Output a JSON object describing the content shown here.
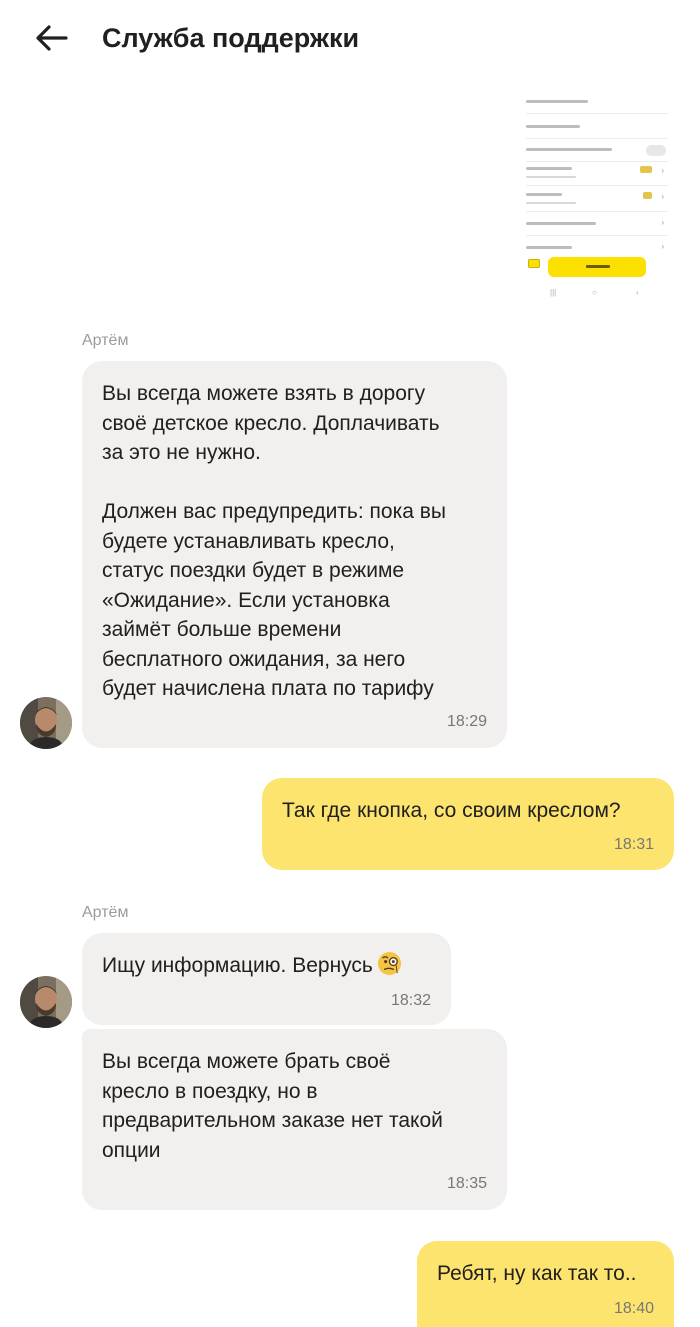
{
  "header": {
    "title": "Служба поддержки",
    "back_icon": "arrow-left-icon"
  },
  "messages": [
    {
      "sender": "Артём",
      "text": "Вы всегда можете взять в дорогу\nсвоё детское кресло. Доплачивать\nза это не нужно.\n\nДолжен вас предупредить: пока вы\nбудете устанавливать кресло,\nстатус поездки будет в режиме\n«Ожидание». Если установка\nзаймёт больше времени\nбесплатного ожидания, за него\nбудет начислена плата по тарифу",
      "time": "18:29"
    },
    {
      "text": "Так где кнопка, со своим креслом?",
      "time": "18:31"
    },
    {
      "sender": "Артём",
      "text": "Ищу информацию. Вернусь",
      "emoji": "monocle-face-emoji",
      "time": "18:32"
    },
    {
      "text": "Вы всегда можете брать своё\nкресло в поездку, но в\nпредварительном заказе нет такой\nопции",
      "time": "18:35"
    },
    {
      "text": "Ребят, ну как так то..",
      "time": "18:40"
    }
  ],
  "colors": {
    "incoming_bubble": "#f1f0ee",
    "outgoing_bubble": "#fce46e",
    "accent": "#fce000"
  }
}
